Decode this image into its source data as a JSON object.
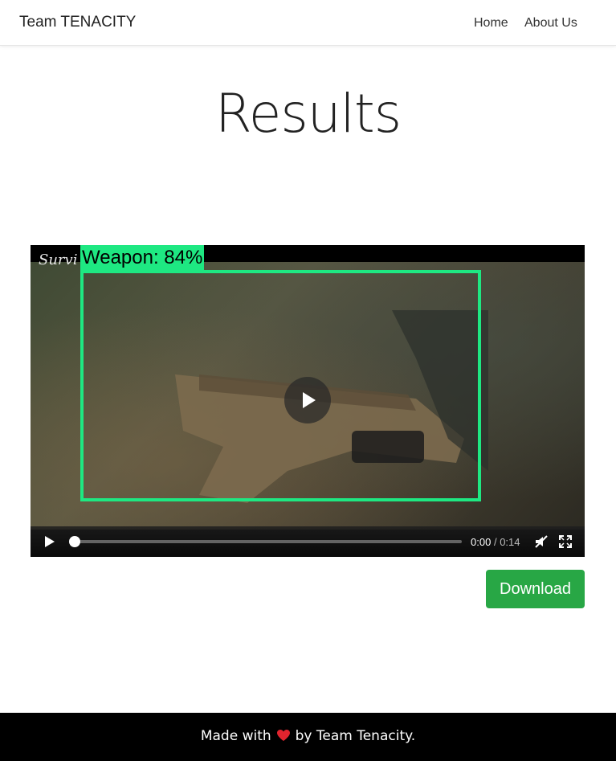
{
  "navbar": {
    "brand": "Team TENACITY",
    "links": [
      "Home",
      "About Us"
    ]
  },
  "page": {
    "title": "Results"
  },
  "video": {
    "watermark": "Survi",
    "detection_label": "Weapon: 84%",
    "current_time": "0:00",
    "separator": "/",
    "duration": "0:14",
    "progress": 0,
    "icons": [
      "play-icon",
      "big-play-icon",
      "mute-icon",
      "fullscreen-icon"
    ],
    "box_color": "#1ee882"
  },
  "actions": {
    "download_label": "Download",
    "download_color": "#28a745"
  },
  "footer": {
    "text_before": "Made with",
    "icon": "heart-icon",
    "text_after": "by Team Tenacity.",
    "heart_color": "#e0242e"
  }
}
